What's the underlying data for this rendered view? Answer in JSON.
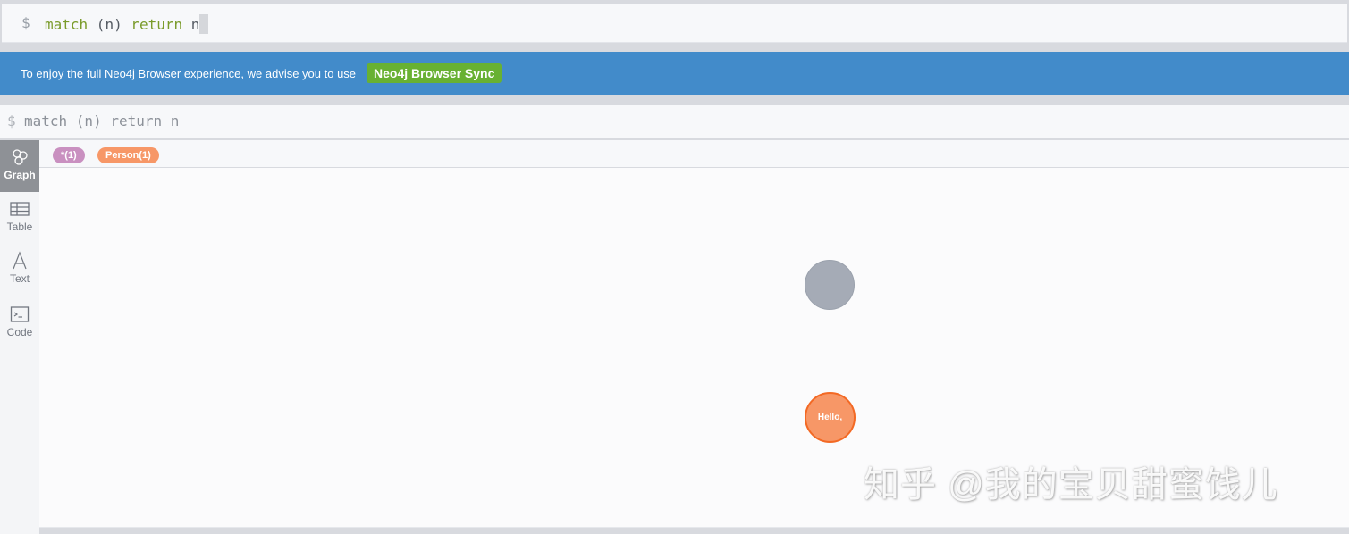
{
  "editor": {
    "prompt": "$",
    "keyword_match": "match",
    "paren_n": " (n) ",
    "keyword_return": "return",
    "var_n": " n"
  },
  "banner": {
    "message": "To enjoy the full Neo4j Browser experience, we advise you to use",
    "button_label": "Neo4j Browser Sync",
    "background": "#428bca",
    "button_color": "#68b132"
  },
  "frame": {
    "prompt": "$",
    "command": "match (n) return n",
    "view_tabs": [
      {
        "label": "Graph",
        "icon": "graph-icon",
        "active": true
      },
      {
        "label": "Table",
        "icon": "table-icon",
        "active": false
      },
      {
        "label": "Text",
        "icon": "text-icon",
        "active": false
      },
      {
        "label": "Code",
        "icon": "code-icon",
        "active": false
      }
    ],
    "labels": [
      {
        "text": "*(1)",
        "color": "#c990c0"
      },
      {
        "text": "Person(1)",
        "color": "#f79767"
      }
    ],
    "nodes": [
      {
        "caption": "",
        "color": "#a5abb6",
        "border": "#9aa1ac"
      },
      {
        "caption": "Hello,",
        "color": "#f79767",
        "border": "#f36924"
      }
    ]
  },
  "watermark": "知乎 @我的宝贝甜蜜饯儿"
}
